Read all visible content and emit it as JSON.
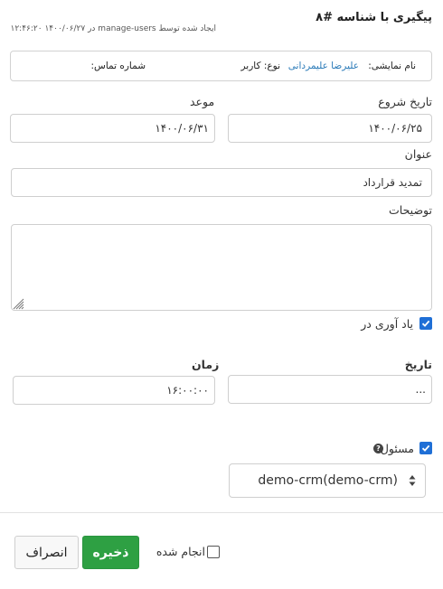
{
  "header": {
    "title": "پیگیری با شناسه #۸",
    "subtitle": "ایجاد شده توسط manage-users در ۱۴۰۰/۰۶/۲۷ ۱۲:۴۶:۲۰"
  },
  "contact": {
    "display_name_label": "نام نمایشی:",
    "display_name_value": "علیرضا علیمردانی",
    "type_text": "نوع: کاربر",
    "phone_label": "شماره تماس:"
  },
  "form": {
    "start_date_label": "تاریخ شروع",
    "start_date_value": "۱۴۰۰/۰۶/۲۵",
    "due_label": "موعد",
    "due_value": "۱۴۰۰/۰۶/۳۱",
    "title_label": "عنوان",
    "title_value": "تمدید قرارداد",
    "description_label": "توضیحات",
    "description_value": "",
    "reminder_label": "یاد آوری در",
    "reminder_checked": true,
    "reminder_date_label": "تاریخ",
    "reminder_date_value": "...",
    "reminder_time_label": "زمان",
    "reminder_time_value": "۱۶:۰۰:۰۰",
    "owner_label": "مسئول",
    "owner_checked": true,
    "owner_help_icon": "question-circle-icon",
    "owner_select_value": "demo-crm(demo-crm)"
  },
  "footer": {
    "done_label": "انجام شده",
    "done_checked": false,
    "save_label": "ذخیره",
    "cancel_label": "انصراف"
  },
  "colors": {
    "accent": "#1f6fd6",
    "save_button": "#2ea043",
    "link": "#2a7ab8"
  }
}
